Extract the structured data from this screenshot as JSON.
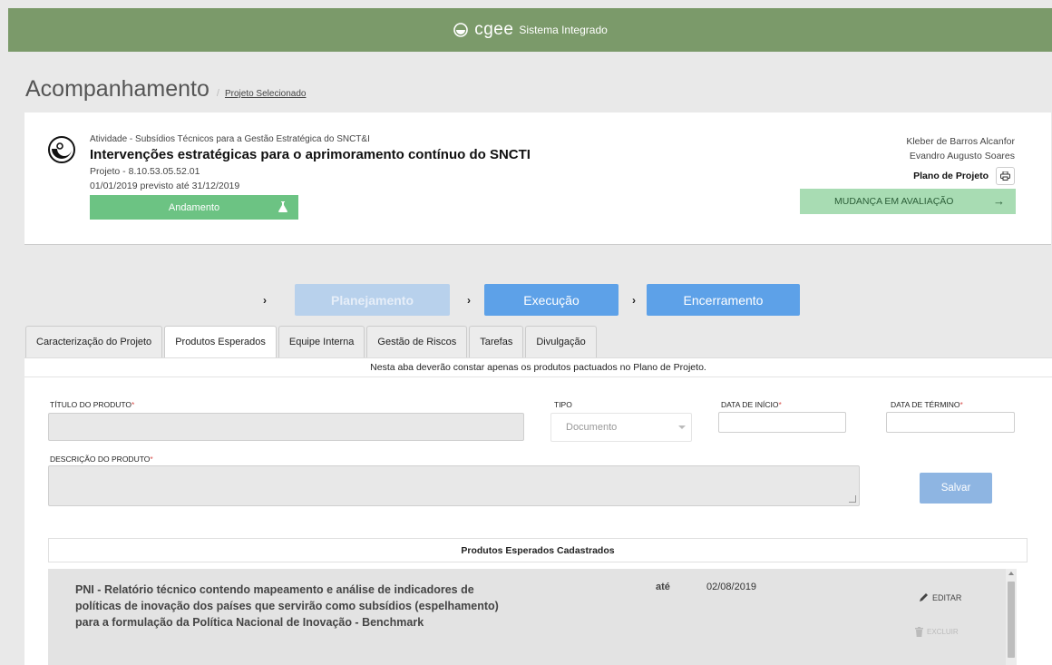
{
  "topbar": {
    "brand": "cgee",
    "system": "Sistema Integrado",
    "logo_icon": "cgee-swirl-icon"
  },
  "header": {
    "title": "Acompanhamento",
    "separator": "/",
    "breadcrumb": "Projeto Selecionado"
  },
  "project": {
    "activity": "Atividade - Subsídios Técnicos para a Gestão Estratégica do SNCT&I",
    "title": "Intervenções estratégicas para o aprimoramento contínuo do SNCTI",
    "code": "Projeto - 8.10.53.05.52.01",
    "dates": "01/01/2019 previsto até 31/12/2019",
    "status": "Andamento",
    "people": [
      "Kleber de Barros Alcanfor",
      "Evandro Augusto Soares"
    ],
    "plan_label": "Plano de Projeto",
    "change_label": "MUDANÇA EM AVALIAÇÃO",
    "change_arrow": "→",
    "colors": {
      "status": "#6cc383",
      "change": "#a8dcb3",
      "topbar": "#7b9a6a"
    }
  },
  "steps": [
    {
      "label": "Planejamento",
      "state": "disabled"
    },
    {
      "label": "Execução",
      "state": "active"
    },
    {
      "label": "Encerramento",
      "state": "active"
    }
  ],
  "tabs": [
    {
      "label": "Caracterização do Projeto",
      "active": false
    },
    {
      "label": "Produtos Esperados",
      "active": true
    },
    {
      "label": "Equipe Interna",
      "active": false
    },
    {
      "label": "Gestão de Riscos",
      "active": false
    },
    {
      "label": "Tarefas",
      "active": false
    },
    {
      "label": "Divulgação",
      "active": false
    }
  ],
  "form": {
    "note": "Nesta aba deverão constar apenas os produtos pactuados no Plano de Projeto.",
    "title_label": "Título do Produto",
    "type_label": "Tipo",
    "type_value": "Documento",
    "start_label": "Data de Início",
    "end_label": "Data de Término",
    "description_label": "Descrição do Produto",
    "required_mark": "*",
    "save_label": "Salvar"
  },
  "list": {
    "header": "Produtos Esperados Cadastrados",
    "rows": [
      {
        "text": "PNI - Relatório técnico contendo mapeamento e análise de indicadores de políticas de inovação dos países que servirão como subsídios (espelhamento) para a formulação da Política Nacional de Inovação - Benchmark",
        "ate": "até",
        "date": "02/08/2019",
        "edit": "EDITAR",
        "delete": "EXCLUIR"
      }
    ]
  }
}
